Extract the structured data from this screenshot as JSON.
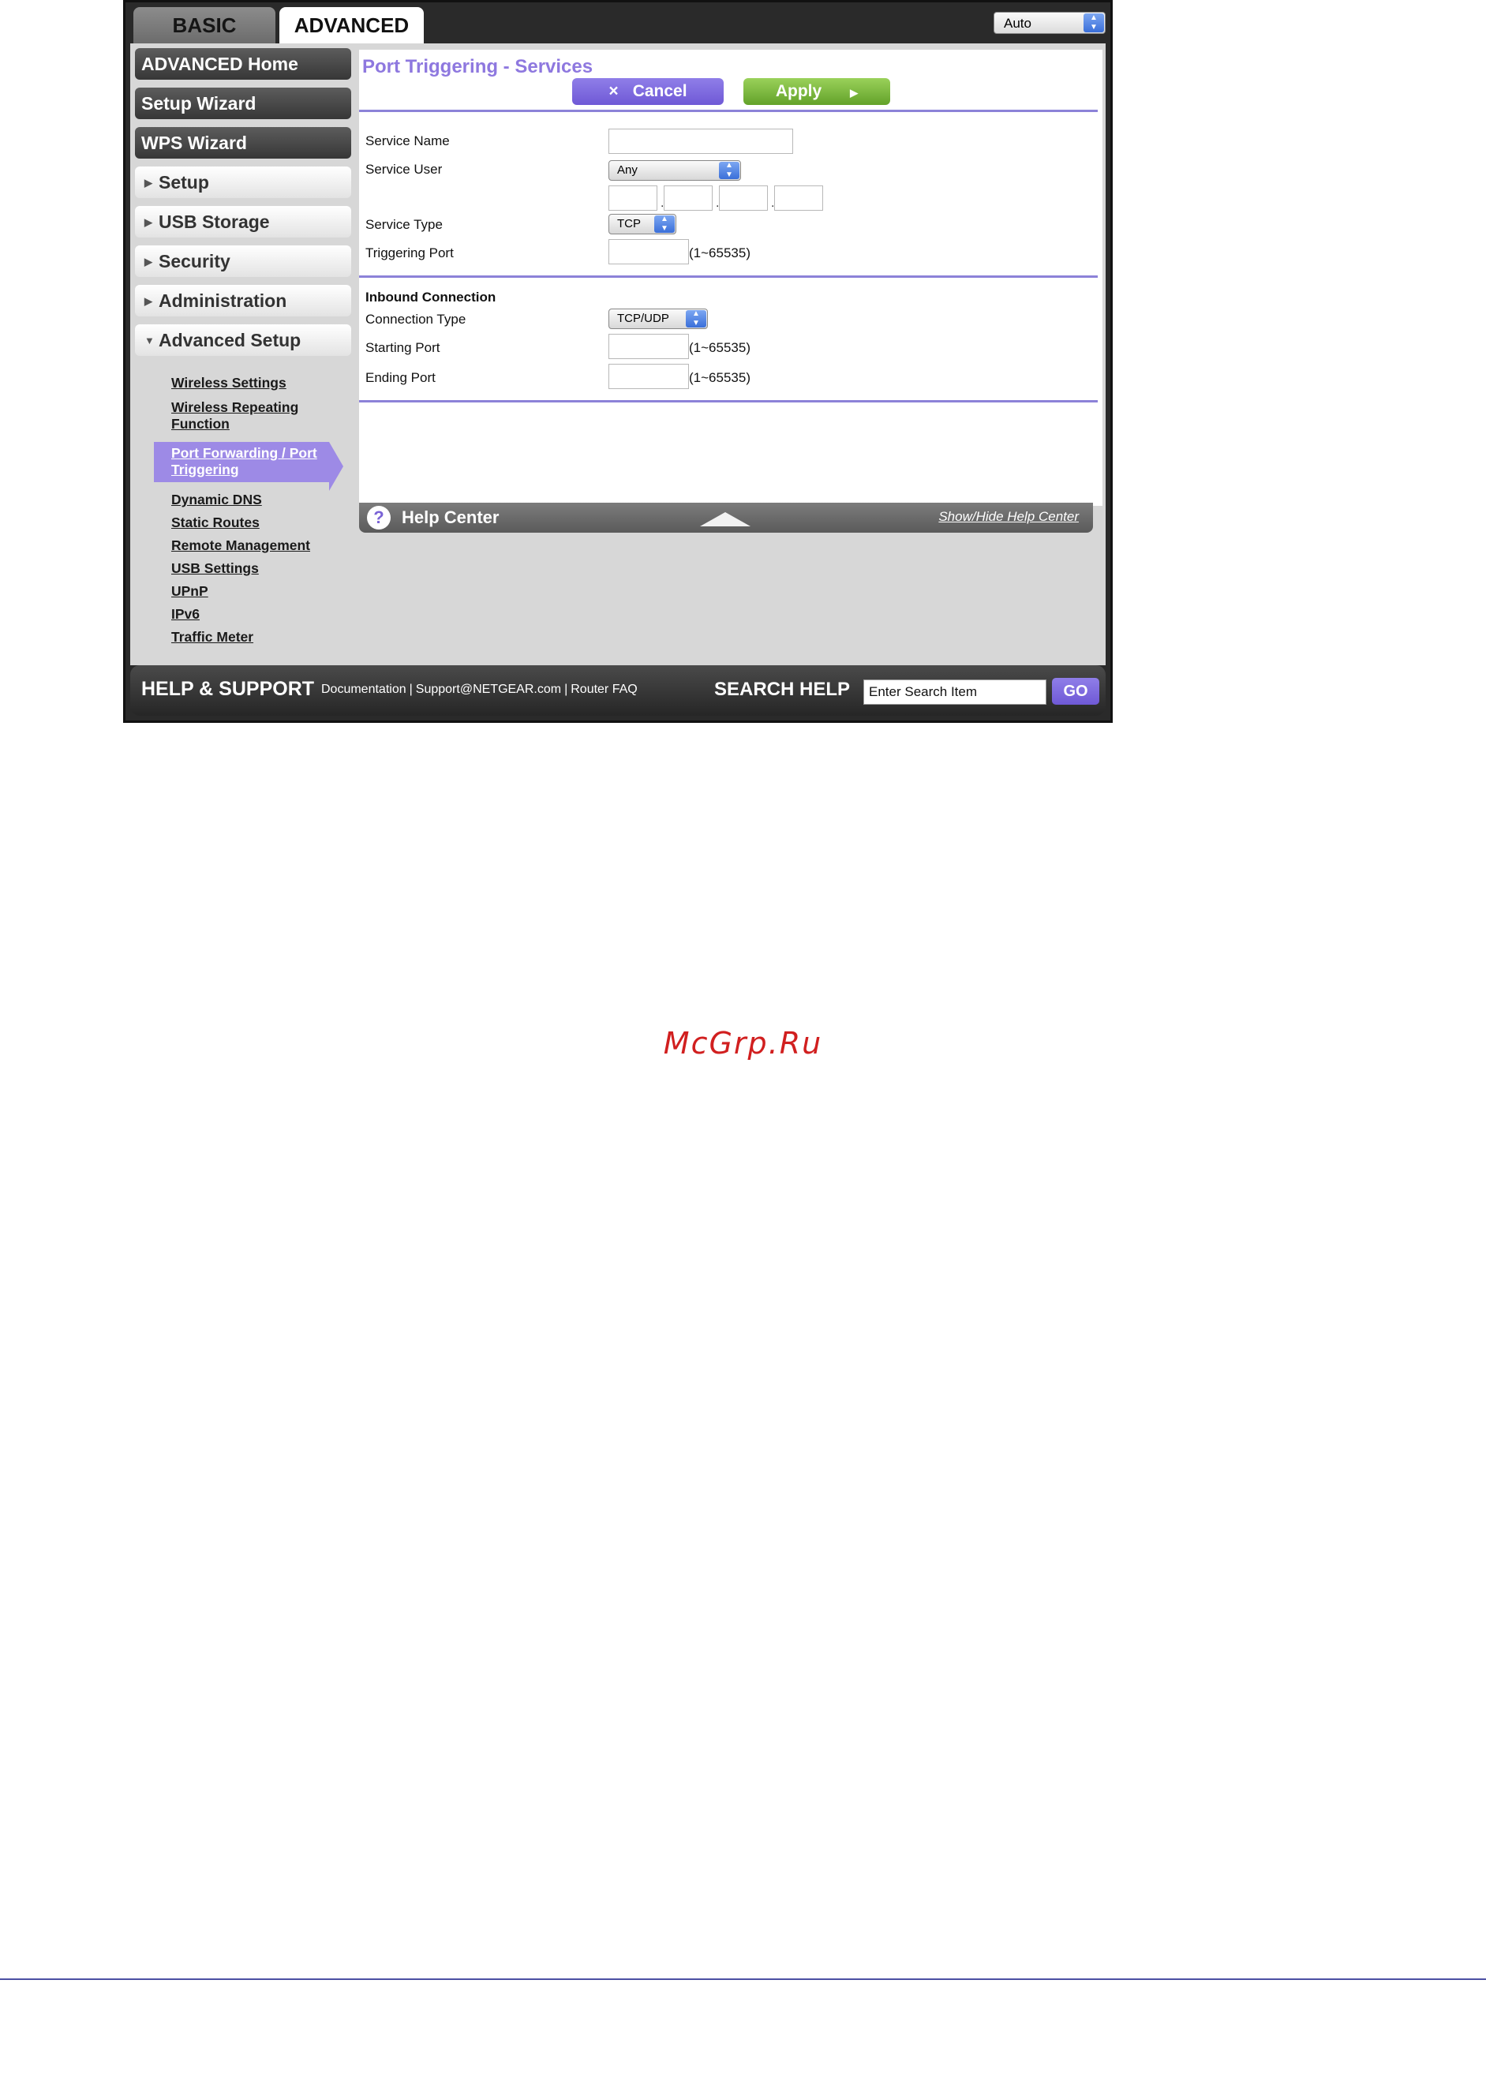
{
  "tabs": {
    "basic": "BASIC",
    "advanced": "ADVANCED"
  },
  "language_select": {
    "value": "Auto"
  },
  "sidebar": {
    "dark_items": [
      "ADVANCED Home",
      "Setup Wizard",
      "WPS Wizard"
    ],
    "light_items": [
      "Setup",
      "USB Storage",
      "Security",
      "Administration",
      "Advanced Setup"
    ],
    "submenu": [
      "Wireless Settings",
      "Wireless Repeating Function",
      "Port Forwarding / Port Triggering",
      "Dynamic DNS",
      "Static Routes",
      "Remote Management",
      "USB Settings",
      "UPnP",
      "IPv6",
      "Traffic Meter"
    ]
  },
  "content": {
    "title": "Port Triggering - Services",
    "cancel_label": "Cancel",
    "apply_label": "Apply",
    "fields": {
      "service_name": "Service Name",
      "service_user": "Service User",
      "service_user_value": "Any",
      "service_type": "Service Type",
      "service_type_value": "TCP",
      "triggering_port": "Triggering Port",
      "range_hint": "(1~65535)"
    },
    "inbound": {
      "heading": "Inbound Connection",
      "connection_type": "Connection Type",
      "connection_type_value": "TCP/UDP",
      "starting_port": "Starting Port",
      "ending_port": "Ending Port"
    }
  },
  "help_center": {
    "title": "Help Center",
    "toggle_label": "Show/Hide Help Center"
  },
  "footer": {
    "title": "HELP & SUPPORT",
    "links": [
      "Documentation",
      "Support@NETGEAR.com",
      "Router FAQ"
    ],
    "search_label": "SEARCH HELP",
    "search_value": "Enter Search Item",
    "go_label": "GO"
  },
  "watermark": "McGrp.Ru"
}
